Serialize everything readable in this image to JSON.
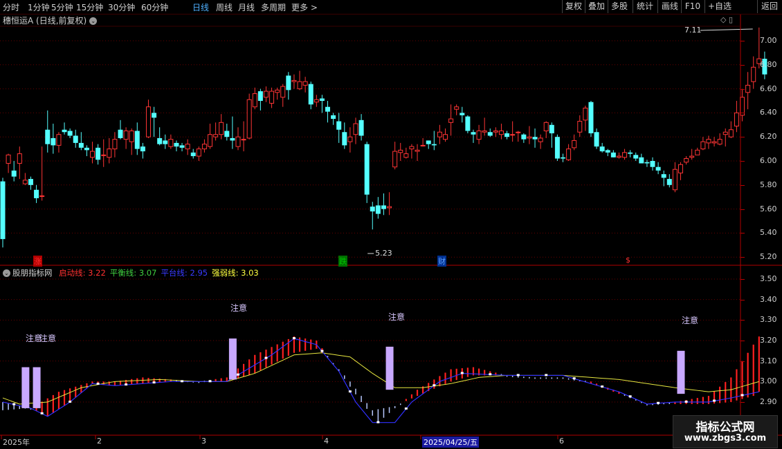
{
  "toolbar": {
    "periods": [
      "分时",
      "1分钟",
      "5分钟",
      "15分钟",
      "30分钟",
      "60分钟",
      "日线",
      "周线",
      "月线",
      "多周期",
      "更多 >"
    ],
    "active": "日线",
    "right_buttons": [
      "复权",
      "叠加",
      "多股",
      "统计",
      "画线",
      "F10",
      "+自选",
      "返回"
    ]
  },
  "main_chart": {
    "title": "穗恒运A (日线,前复权)",
    "price_axis": [
      "7.00",
      "6.80",
      "6.60",
      "6.40",
      "6.20",
      "6.00",
      "5.80",
      "5.60",
      "5.40",
      "5.20"
    ],
    "high_annotation": "7.11",
    "low_annotation": "5.23",
    "markers": [
      {
        "label": "涨",
        "color": "#ff3030"
      },
      {
        "label": "跌",
        "color": "#00c000"
      },
      {
        "label": "财",
        "color": "#5fa0ff"
      },
      {
        "label": "$",
        "color": "#ff3030"
      }
    ],
    "candles": [
      [
        5.83,
        5.35,
        5.86,
        5.28
      ],
      [
        5.98,
        6.05,
        6.06,
        5.9
      ],
      [
        5.92,
        5.87,
        6.0,
        5.83
      ],
      [
        5.98,
        6.06,
        6.12,
        5.85
      ],
      [
        5.81,
        5.84,
        5.9,
        5.8
      ],
      [
        5.85,
        5.8,
        5.87,
        5.76
      ],
      [
        5.76,
        5.69,
        5.8,
        5.65
      ],
      [
        5.71,
        5.71,
        6.12,
        5.67
      ],
      [
        6.26,
        6.14,
        6.42,
        6.07
      ],
      [
        6.19,
        6.13,
        6.31,
        6.06
      ],
      [
        6.13,
        6.22,
        6.24,
        6.07
      ],
      [
        6.26,
        6.24,
        6.32,
        6.22
      ],
      [
        6.25,
        6.21,
        6.27,
        6.19
      ],
      [
        6.21,
        6.15,
        6.26,
        6.11
      ],
      [
        6.15,
        6.11,
        6.24,
        6.09
      ],
      [
        6.11,
        6.09,
        6.13,
        6.04
      ],
      [
        6.03,
        6.08,
        6.16,
        5.98
      ],
      [
        6.11,
        6.01,
        6.14,
        5.97
      ],
      [
        6.05,
        6.05,
        6.18,
        5.95
      ],
      [
        6.03,
        6.1,
        6.19,
        5.98
      ],
      [
        6.1,
        6.18,
        6.24,
        6.03
      ],
      [
        6.26,
        6.19,
        6.34,
        6.18
      ],
      [
        6.18,
        6.25,
        6.28,
        6.1
      ],
      [
        6.16,
        6.25,
        6.27,
        6.05
      ],
      [
        6.25,
        6.1,
        6.32,
        6.05
      ],
      [
        6.12,
        6.08,
        6.15,
        6.02
      ],
      [
        6.2,
        6.45,
        6.51,
        6.19
      ],
      [
        6.4,
        6.36,
        6.45,
        6.2
      ],
      [
        6.19,
        6.14,
        6.28,
        6.13
      ],
      [
        6.17,
        6.14,
        6.22,
        6.1
      ],
      [
        6.12,
        6.18,
        6.22,
        6.1
      ],
      [
        6.15,
        6.12,
        6.17,
        6.08
      ],
      [
        6.13,
        6.11,
        6.15,
        6.08
      ],
      [
        6.1,
        6.14,
        6.18,
        6.05
      ],
      [
        6.07,
        6.04,
        6.1,
        6.02
      ],
      [
        6.04,
        6.1,
        6.12,
        6.0
      ],
      [
        6.1,
        6.14,
        6.18,
        6.07
      ],
      [
        6.12,
        6.22,
        6.31,
        6.1
      ],
      [
        6.2,
        6.22,
        6.32,
        6.17
      ],
      [
        6.22,
        6.32,
        6.39,
        6.18
      ],
      [
        6.25,
        6.2,
        6.31,
        6.17
      ],
      [
        6.19,
        6.17,
        6.37,
        6.1
      ],
      [
        6.12,
        6.2,
        6.28,
        6.09
      ],
      [
        6.18,
        6.18,
        6.33,
        6.08
      ],
      [
        6.19,
        6.51,
        6.56,
        6.18
      ],
      [
        6.45,
        6.56,
        6.61,
        6.43
      ],
      [
        6.58,
        6.5,
        6.6,
        6.42
      ],
      [
        6.53,
        6.58,
        6.62,
        6.49
      ],
      [
        6.48,
        6.58,
        6.61,
        6.44
      ],
      [
        6.57,
        6.59,
        6.61,
        6.51
      ],
      [
        6.53,
        6.62,
        6.64,
        6.45
      ],
      [
        6.71,
        6.59,
        6.74,
        6.51
      ],
      [
        6.66,
        6.67,
        6.72,
        6.6
      ],
      [
        6.6,
        6.66,
        6.75,
        6.59
      ],
      [
        6.63,
        6.66,
        6.7,
        6.57
      ],
      [
        6.64,
        6.47,
        6.66,
        6.43
      ],
      [
        6.49,
        6.51,
        6.55,
        6.45
      ],
      [
        6.52,
        6.5,
        6.55,
        6.4
      ],
      [
        6.45,
        6.41,
        6.5,
        6.32
      ],
      [
        6.38,
        6.35,
        6.4,
        6.3
      ],
      [
        6.33,
        6.26,
        6.4,
        6.15
      ],
      [
        6.24,
        6.13,
        6.32,
        6.1
      ],
      [
        6.16,
        6.2,
        6.28,
        6.07
      ],
      [
        6.22,
        6.31,
        6.36,
        6.14
      ],
      [
        6.34,
        6.21,
        6.39,
        6.17
      ],
      [
        6.14,
        5.72,
        6.16,
        5.65
      ],
      [
        5.62,
        5.58,
        5.66,
        5.43
      ],
      [
        5.63,
        5.56,
        5.7,
        5.52
      ],
      [
        5.63,
        5.6,
        5.73,
        5.55
      ],
      [
        5.61,
        5.62,
        5.74,
        5.55
      ],
      [
        5.95,
        6.08,
        6.16,
        5.93
      ],
      [
        6.07,
        6.09,
        6.15,
        6.0
      ],
      [
        6.03,
        6.06,
        6.11,
        6.02
      ],
      [
        6.1,
        6.12,
        6.14,
        6.02
      ],
      [
        6.08,
        6.09,
        6.14,
        6.0
      ],
      [
        6.13,
        6.13,
        6.19,
        6.12
      ],
      [
        6.17,
        6.14,
        6.17,
        6.1
      ],
      [
        6.14,
        6.13,
        6.25,
        6.09
      ],
      [
        6.2,
        6.24,
        6.3,
        6.14
      ],
      [
        6.18,
        6.22,
        6.27,
        6.16
      ],
      [
        6.32,
        6.35,
        6.47,
        6.21
      ],
      [
        6.43,
        6.45,
        6.47,
        6.38
      ],
      [
        6.4,
        6.38,
        6.45,
        6.32
      ],
      [
        6.37,
        6.25,
        6.38,
        6.23
      ],
      [
        6.24,
        6.22,
        6.26,
        6.15
      ],
      [
        6.18,
        6.25,
        6.3,
        6.14
      ],
      [
        6.24,
        6.25,
        6.36,
        6.21
      ],
      [
        6.24,
        6.21,
        6.27,
        6.2
      ],
      [
        6.24,
        6.25,
        6.28,
        6.2
      ],
      [
        6.22,
        6.25,
        6.31,
        6.18
      ],
      [
        6.23,
        6.2,
        6.25,
        6.18
      ],
      [
        6.22,
        6.22,
        6.33,
        6.16
      ],
      [
        6.24,
        6.24,
        6.25,
        6.16
      ],
      [
        6.22,
        6.18,
        6.23,
        6.15
      ],
      [
        6.19,
        6.2,
        6.29,
        6.14
      ],
      [
        6.2,
        6.18,
        6.27,
        6.11
      ],
      [
        6.16,
        6.19,
        6.22,
        6.1
      ],
      [
        6.25,
        6.32,
        6.33,
        6.19
      ],
      [
        6.3,
        6.23,
        6.32,
        6.11
      ],
      [
        6.2,
        6.02,
        6.22,
        6.0
      ],
      [
        6.03,
        6.02,
        6.06,
        5.99
      ],
      [
        6.01,
        6.1,
        6.14,
        6.0
      ],
      [
        6.11,
        6.17,
        6.22,
        6.09
      ],
      [
        6.24,
        6.33,
        6.38,
        6.2
      ],
      [
        6.34,
        6.44,
        6.46,
        6.25
      ],
      [
        6.49,
        6.23,
        6.5,
        6.2
      ],
      [
        6.24,
        6.12,
        6.27,
        6.1
      ],
      [
        6.12,
        6.08,
        6.15,
        6.07
      ],
      [
        6.09,
        6.07,
        6.1,
        6.04
      ],
      [
        6.07,
        6.03,
        6.09,
        6.03
      ],
      [
        6.03,
        6.04,
        6.07,
        6.02
      ],
      [
        6.03,
        6.07,
        6.1,
        6.01
      ],
      [
        6.07,
        6.06,
        6.09,
        6.03
      ],
      [
        6.05,
        6.02,
        6.07,
        6.0
      ],
      [
        6.03,
        5.98,
        6.06,
        5.98
      ],
      [
        5.99,
        5.98,
        6.01,
        5.95
      ],
      [
        6.0,
        5.95,
        6.03,
        5.92
      ],
      [
        5.95,
        5.92,
        5.99,
        5.89
      ],
      [
        5.89,
        5.86,
        5.92,
        5.79
      ],
      [
        5.85,
        5.8,
        5.89,
        5.78
      ],
      [
        5.76,
        5.93,
        5.99,
        5.74
      ],
      [
        5.9,
        5.97,
        5.99,
        5.84
      ],
      [
        5.99,
        6.02,
        6.04,
        5.97
      ],
      [
        6.03,
        6.04,
        6.1,
        6.01
      ],
      [
        6.05,
        6.09,
        6.11,
        6.06
      ],
      [
        6.1,
        6.16,
        6.2,
        6.09
      ],
      [
        6.15,
        6.18,
        6.21,
        6.1
      ],
      [
        6.15,
        6.16,
        6.2,
        6.12
      ],
      [
        6.14,
        6.18,
        6.23,
        6.13
      ],
      [
        6.22,
        6.24,
        6.27,
        6.12
      ],
      [
        6.2,
        6.26,
        6.33,
        6.19
      ],
      [
        6.29,
        6.4,
        6.5,
        6.24
      ],
      [
        6.38,
        6.53,
        6.6,
        6.33
      ],
      [
        6.57,
        6.63,
        6.74,
        6.43
      ],
      [
        6.66,
        6.78,
        6.87,
        6.6
      ],
      [
        6.81,
        6.85,
        7.11,
        6.77
      ],
      [
        6.85,
        6.72,
        6.91,
        6.68
      ]
    ]
  },
  "indicator": {
    "name": "股朋指标网",
    "lines": [
      {
        "label": "启动线: 3.22",
        "color": "#ff3030"
      },
      {
        "label": "平衡线: 3.07",
        "color": "#40d040"
      },
      {
        "label": "平台线: 2.95",
        "color": "#3a3aff"
      },
      {
        "label": "强弱线: 3.03",
        "color": "#ffff40"
      }
    ],
    "axis": [
      "3.50",
      "3.40",
      "3.30",
      "3.20",
      "3.10",
      "3.00",
      "2.90"
    ],
    "notes": [
      "注意",
      "注意",
      "注意",
      "注意",
      "注意"
    ]
  },
  "date_axis": [
    "2025年",
    "2",
    "3",
    "4",
    "2025/04/25/五",
    "6"
  ],
  "watermark": {
    "line1": "指标公式网",
    "line2": "www.zbgs3.com"
  },
  "corner_icons": "◇ ▯"
}
